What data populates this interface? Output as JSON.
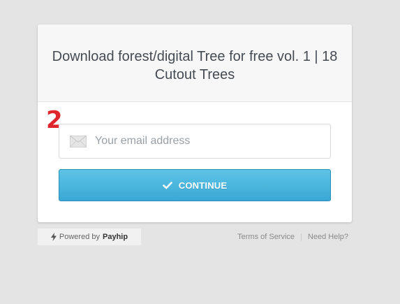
{
  "product": {
    "title": "Download forest/digital Tree for free vol. 1 | 18 Cutout Trees"
  },
  "annotation": {
    "step": "2"
  },
  "email": {
    "placeholder": "Your email address",
    "value": "",
    "icon": "envelope-icon"
  },
  "continue_button": {
    "label": "CONTINUE",
    "icon": "checkmark-icon"
  },
  "footer": {
    "powered_by": "Powered by",
    "brand": "Payhip",
    "icon": "lightning-bolt-icon",
    "links": {
      "terms": "Terms of Service",
      "separator": "|",
      "help": "Need Help?"
    }
  },
  "colors": {
    "page_background": "#e4e4e4",
    "button_gradient_top": "#5ec4e6",
    "button_gradient_bottom": "#3aa8d4",
    "annotation_red": "#e0262d"
  }
}
